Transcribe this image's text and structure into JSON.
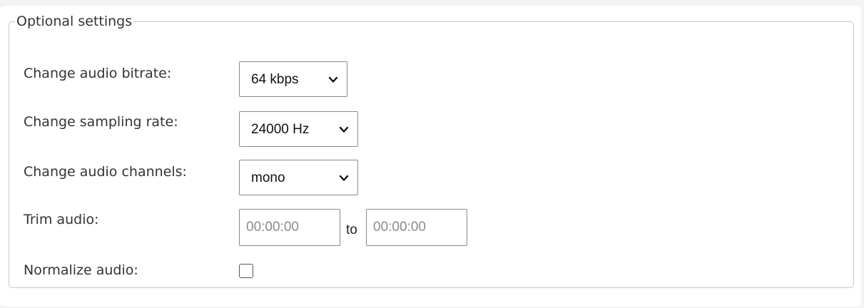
{
  "section": {
    "legend": "Optional settings"
  },
  "bitrate": {
    "label": "Change audio bitrate:",
    "selected": "64 kbps"
  },
  "sampling": {
    "label": "Change sampling rate:",
    "selected": "24000 Hz"
  },
  "channels": {
    "label": "Change audio channels:",
    "selected": "mono"
  },
  "trim": {
    "label": "Trim audio:",
    "start_placeholder": "00:00:00",
    "separator": "to",
    "end_placeholder": "00:00:00"
  },
  "normalize": {
    "label": "Normalize audio:",
    "checked": false
  },
  "icons": {
    "dropdown": "chevron-down-icon"
  }
}
